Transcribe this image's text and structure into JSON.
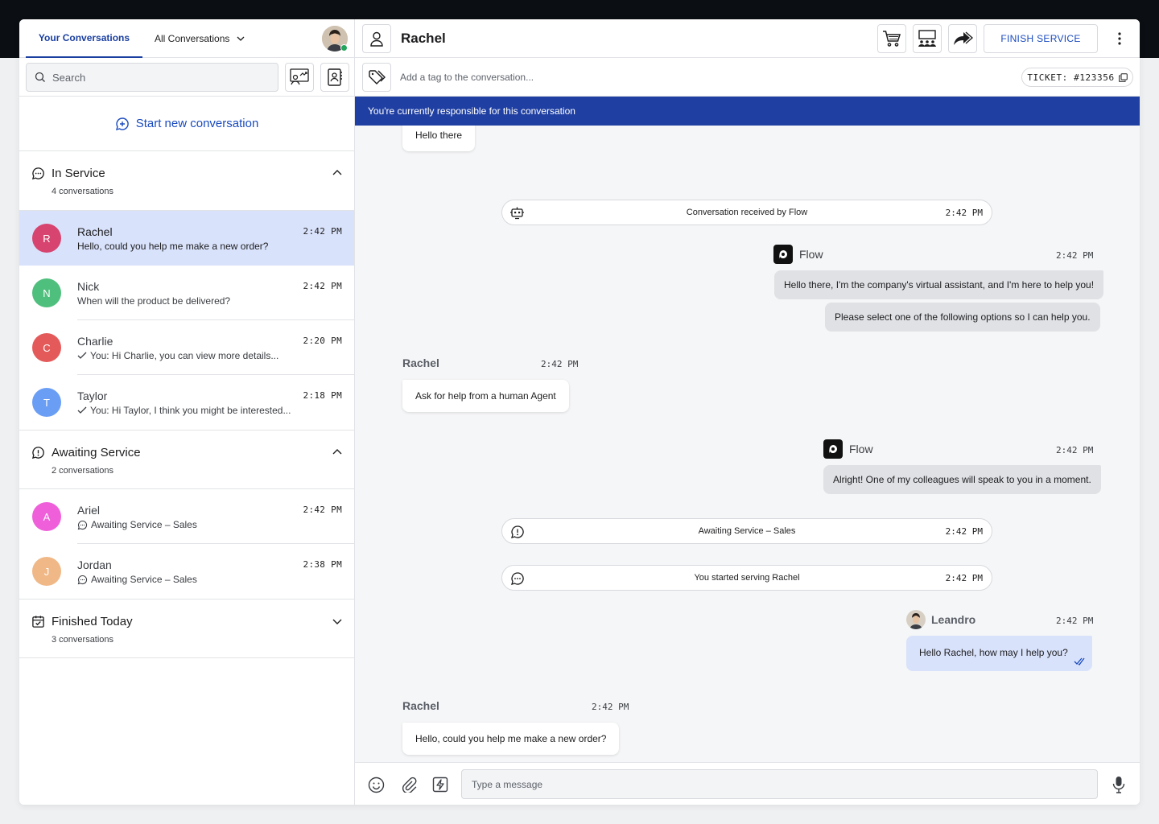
{
  "sidebar": {
    "tabs": {
      "your": "Your Conversations",
      "all": "All Conversations"
    },
    "search_placeholder": "Search",
    "new_conversation": "Start new conversation",
    "sections": [
      {
        "title": "In Service",
        "count": "4 conversations",
        "icon": "chat-bubbles-icon",
        "expanded": true
      },
      {
        "title": "Awaiting Service",
        "count": "2 conversations",
        "icon": "chat-alert-icon",
        "expanded": true
      },
      {
        "title": "Finished Today",
        "count": "3 conversations",
        "icon": "calendar-check-icon",
        "expanded": false
      }
    ],
    "conversations": [
      {
        "initial": "R",
        "name": "Rachel",
        "time": "2:42 PM",
        "snippet": "Hello, could you help me make a new order?",
        "color": "#d6446f",
        "active": true
      },
      {
        "initial": "N",
        "name": "Nick",
        "time": "2:42 PM",
        "snippet": "When will the product be delivered?",
        "color": "#4fbf7d"
      },
      {
        "initial": "C",
        "name": "Charlie",
        "time": "2:20 PM",
        "snippet": "You: Hi Charlie, you can view more details...",
        "color": "#e45a5a",
        "icon": "check-icon"
      },
      {
        "initial": "T",
        "name": "Taylor",
        "time": "2:18 PM",
        "snippet": "You: Hi Taylor, I think you might be interested...",
        "color": "#6a9ef5",
        "icon": "check-icon"
      },
      {
        "initial": "A",
        "name": "Ariel",
        "time": "2:42 PM",
        "snippet": "Awaiting Service – Sales",
        "color": "#ef5fd9",
        "icon": "chat-icon"
      },
      {
        "initial": "J",
        "name": "Jordan",
        "time": "2:38 PM",
        "snippet": "Awaiting Service – Sales",
        "color": "#f0b887",
        "icon": "chat-icon"
      }
    ]
  },
  "chat": {
    "contact_name": "Rachel",
    "finish_label": "FINISH SERVICE",
    "tag_placeholder": "Add a tag to the conversation...",
    "ticket": "TICKET: #123356",
    "banner": "You're currently responsible for this conversation",
    "messages": {
      "m0": "Hello there",
      "e1": {
        "text": "Conversation received by Flow",
        "time": "2:42 PM"
      },
      "flow1": {
        "sender": "Flow",
        "time": "2:42 PM",
        "b1": "Hello there, I'm the company's virtual assistant, and I'm here to help you!",
        "b2": "Please select one of the following options so I can help you."
      },
      "rachel1": {
        "sender": "Rachel",
        "time": "2:42 PM",
        "text": "Ask for help from a human Agent"
      },
      "flow2": {
        "sender": "Flow",
        "time": "2:42 PM",
        "text": "Alright! One of my colleagues will speak to you in a moment."
      },
      "e2": {
        "text": "Awaiting Service – Sales",
        "time": "2:42 PM"
      },
      "e3": {
        "text": "You started serving Rachel",
        "time": "2:42 PM"
      },
      "agent1": {
        "sender": "Leandro",
        "time": "2:42 PM",
        "text": "Hello Rachel, how may I help you?"
      },
      "rachel2": {
        "sender": "Rachel",
        "time": "2:42 PM",
        "text": "Hello, could you help me make a new order?"
      }
    },
    "composer_placeholder": "Type a message"
  },
  "colors": {
    "accent": "#1a4bbf",
    "banner": "#1f3fa2",
    "active_row": "#d9e2fb",
    "agent_bubble": "#d9e2fb"
  }
}
